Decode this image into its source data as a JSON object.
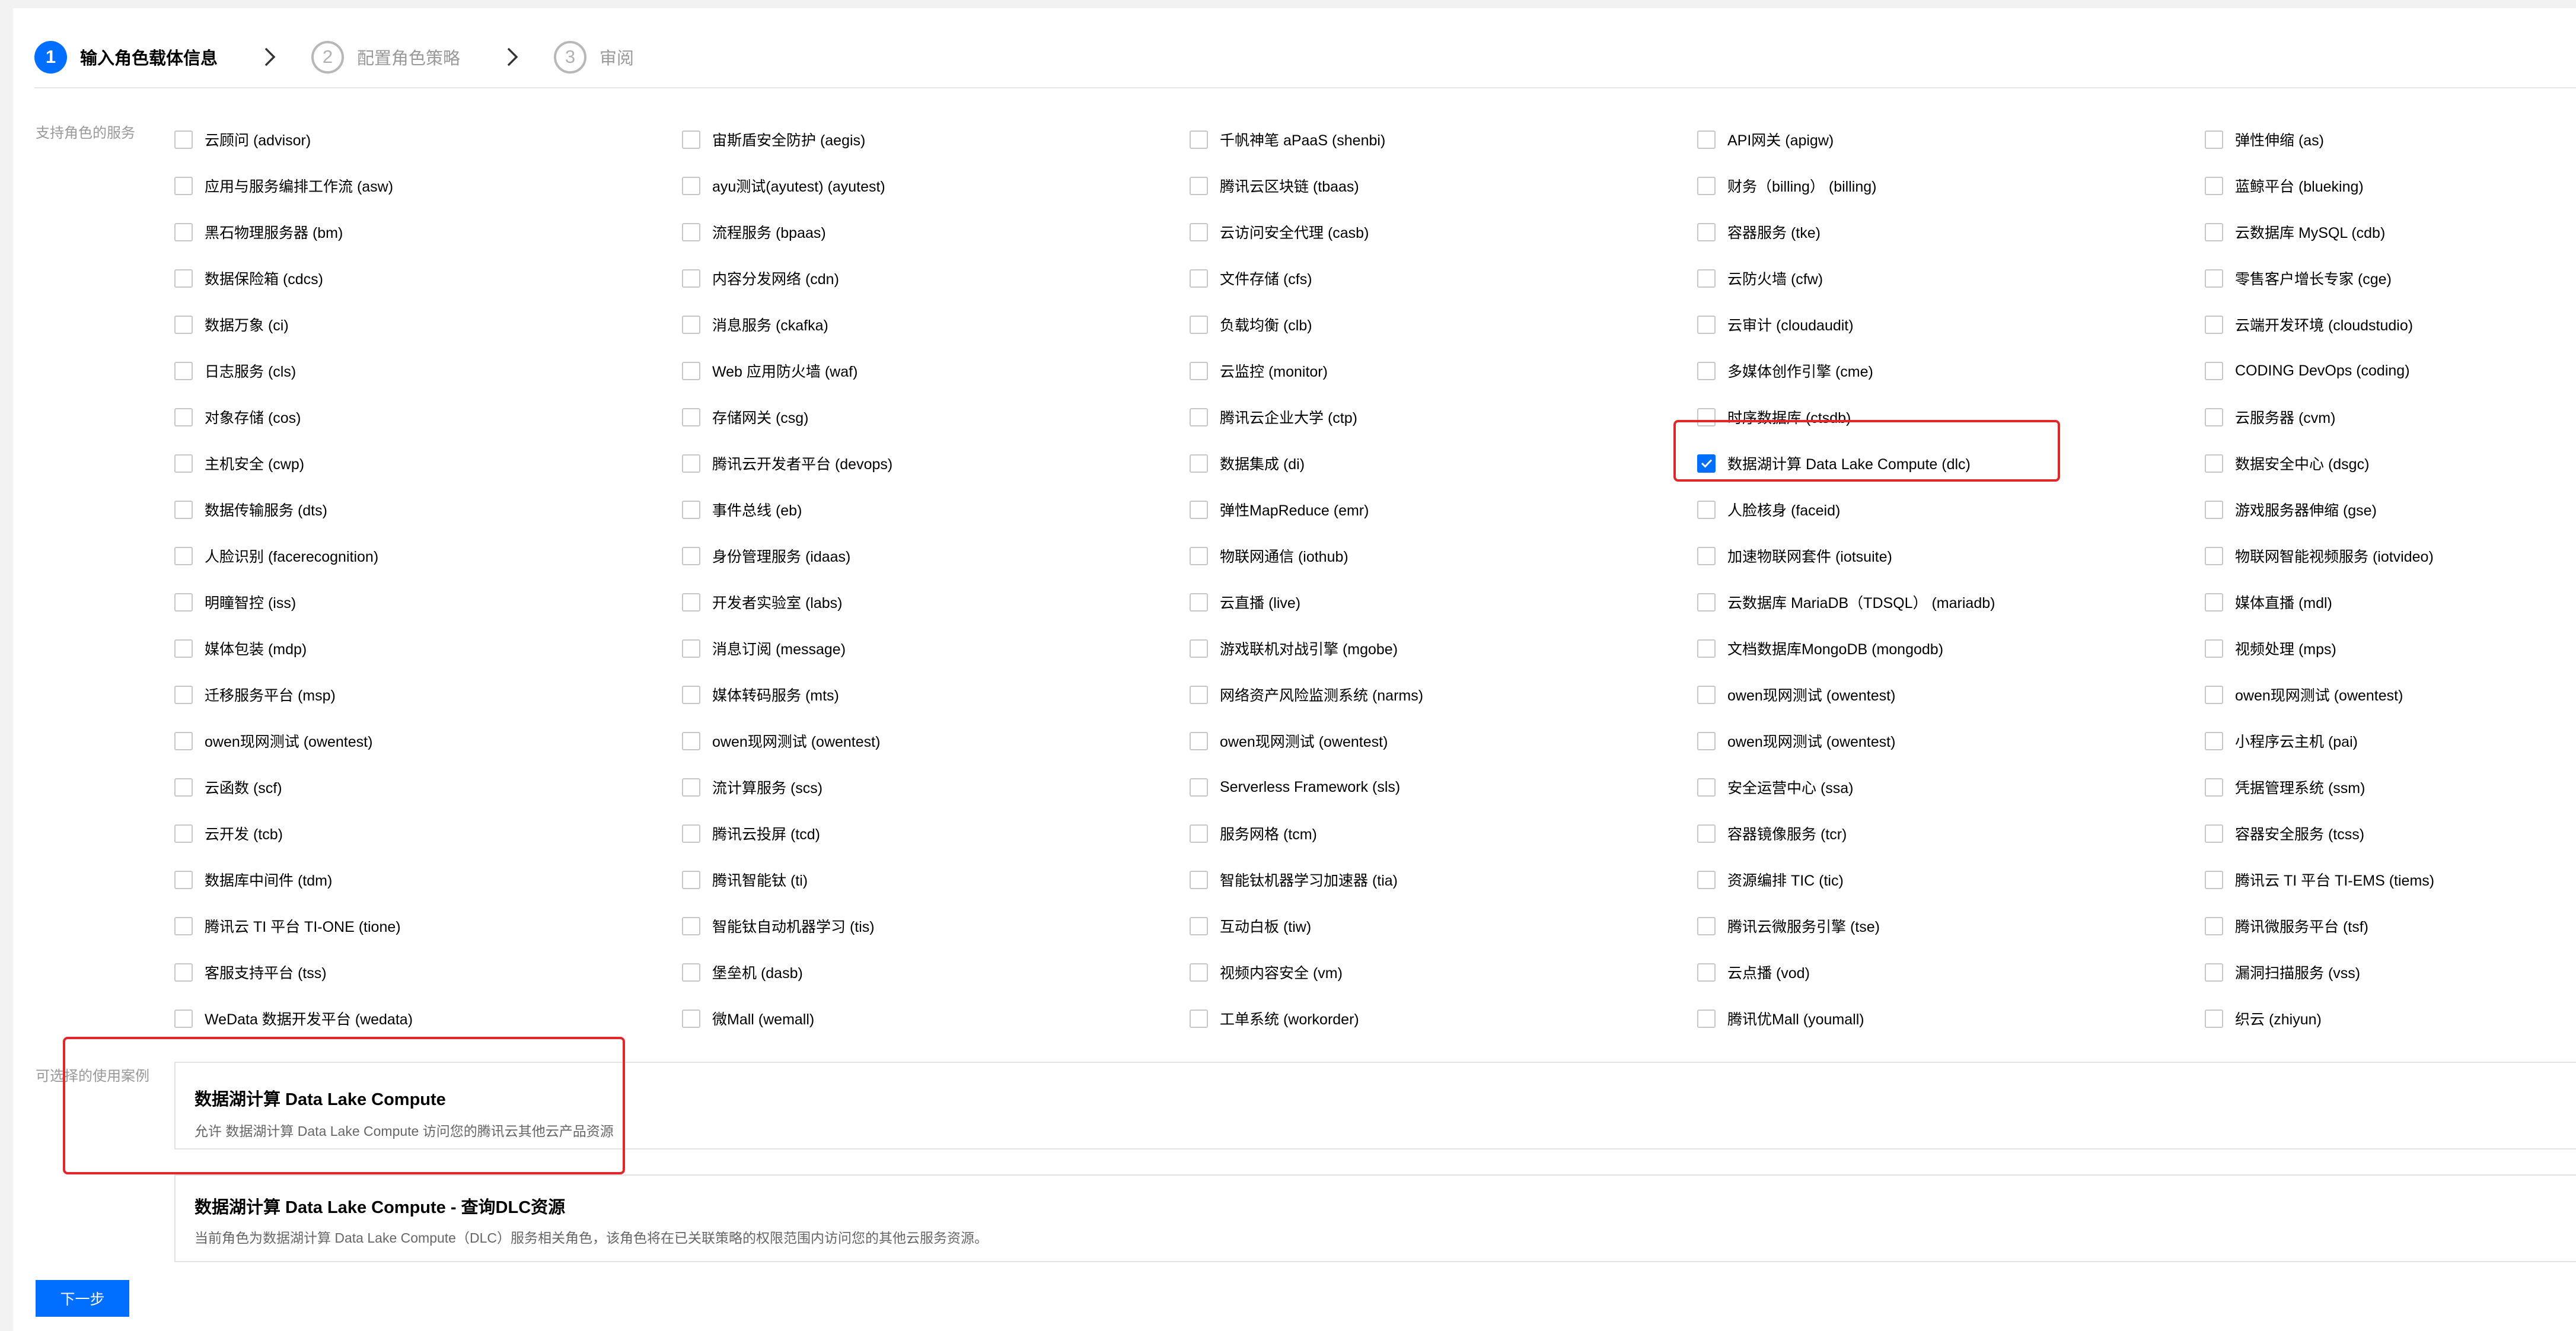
{
  "steps": [
    {
      "num": "1",
      "label": "输入角色载体信息"
    },
    {
      "num": "2",
      "label": "配置角色策略"
    },
    {
      "num": "3",
      "label": "审阅"
    }
  ],
  "services_label": "支持角色的服务",
  "use_cases_label": "可选择的使用案例",
  "services": [
    {
      "label": "云顾问 (advisor)",
      "checked": false
    },
    {
      "label": "宙斯盾安全防护 (aegis)",
      "checked": false
    },
    {
      "label": "千帆神笔 aPaaS (shenbi)",
      "checked": false
    },
    {
      "label": "API网关 (apigw)",
      "checked": false
    },
    {
      "label": "弹性伸缩 (as)",
      "checked": false
    },
    {
      "label": "应用与服务编排工作流 (asw)",
      "checked": false
    },
    {
      "label": "ayu测试(ayutest) (ayutest)",
      "checked": false
    },
    {
      "label": "腾讯云区块链 (tbaas)",
      "checked": false
    },
    {
      "label": "财务（billing） (billing)",
      "checked": false
    },
    {
      "label": "蓝鲸平台 (blueking)",
      "checked": false
    },
    {
      "label": "黑石物理服务器 (bm)",
      "checked": false
    },
    {
      "label": "流程服务 (bpaas)",
      "checked": false
    },
    {
      "label": "云访问安全代理 (casb)",
      "checked": false
    },
    {
      "label": "容器服务 (tke)",
      "checked": false
    },
    {
      "label": "云数据库 MySQL (cdb)",
      "checked": false
    },
    {
      "label": "数据保险箱 (cdcs)",
      "checked": false
    },
    {
      "label": "内容分发网络 (cdn)",
      "checked": false
    },
    {
      "label": "文件存储 (cfs)",
      "checked": false
    },
    {
      "label": "云防火墙 (cfw)",
      "checked": false
    },
    {
      "label": "零售客户增长专家 (cge)",
      "checked": false
    },
    {
      "label": "数据万象 (ci)",
      "checked": false
    },
    {
      "label": "消息服务 (ckafka)",
      "checked": false
    },
    {
      "label": "负载均衡 (clb)",
      "checked": false
    },
    {
      "label": "云审计 (cloudaudit)",
      "checked": false
    },
    {
      "label": "云端开发环境 (cloudstudio)",
      "checked": false
    },
    {
      "label": "日志服务 (cls)",
      "checked": false
    },
    {
      "label": "Web 应用防火墙 (waf)",
      "checked": false
    },
    {
      "label": "云监控 (monitor)",
      "checked": false
    },
    {
      "label": "多媒体创作引擎 (cme)",
      "checked": false
    },
    {
      "label": "CODING DevOps (coding)",
      "checked": false
    },
    {
      "label": "对象存储 (cos)",
      "checked": false
    },
    {
      "label": "存储网关 (csg)",
      "checked": false
    },
    {
      "label": "腾讯云企业大学 (ctp)",
      "checked": false
    },
    {
      "label": "时序数据库 (ctsdb)",
      "checked": false
    },
    {
      "label": "云服务器 (cvm)",
      "checked": false
    },
    {
      "label": "主机安全 (cwp)",
      "checked": false
    },
    {
      "label": "腾讯云开发者平台 (devops)",
      "checked": false
    },
    {
      "label": "数据集成 (di)",
      "checked": false
    },
    {
      "label": "数据湖计算 Data Lake Compute (dlc)",
      "checked": true
    },
    {
      "label": "数据安全中心 (dsgc)",
      "checked": false
    },
    {
      "label": "数据传输服务 (dts)",
      "checked": false
    },
    {
      "label": "事件总线 (eb)",
      "checked": false
    },
    {
      "label": "弹性MapReduce (emr)",
      "checked": false
    },
    {
      "label": "人脸核身 (faceid)",
      "checked": false
    },
    {
      "label": "游戏服务器伸缩 (gse)",
      "checked": false
    },
    {
      "label": "人脸识别 (facerecognition)",
      "checked": false
    },
    {
      "label": "身份管理服务 (idaas)",
      "checked": false
    },
    {
      "label": "物联网通信 (iothub)",
      "checked": false
    },
    {
      "label": "加速物联网套件 (iotsuite)",
      "checked": false
    },
    {
      "label": "物联网智能视频服务 (iotvideo)",
      "checked": false
    },
    {
      "label": "明瞳智控 (iss)",
      "checked": false
    },
    {
      "label": "开发者实验室 (labs)",
      "checked": false
    },
    {
      "label": "云直播 (live)",
      "checked": false
    },
    {
      "label": "云数据库 MariaDB（TDSQL） (mariadb)",
      "checked": false
    },
    {
      "label": "媒体直播 (mdl)",
      "checked": false
    },
    {
      "label": "媒体包装 (mdp)",
      "checked": false
    },
    {
      "label": "消息订阅 (message)",
      "checked": false
    },
    {
      "label": "游戏联机对战引擎 (mgobe)",
      "checked": false
    },
    {
      "label": "文档数据库MongoDB (mongodb)",
      "checked": false
    },
    {
      "label": "视频处理 (mps)",
      "checked": false
    },
    {
      "label": "迁移服务平台 (msp)",
      "checked": false
    },
    {
      "label": "媒体转码服务 (mts)",
      "checked": false
    },
    {
      "label": "网络资产风险监测系统 (narms)",
      "checked": false
    },
    {
      "label": "owen现网测试 (owentest)",
      "checked": false
    },
    {
      "label": "owen现网测试 (owentest)",
      "checked": false
    },
    {
      "label": "owen现网测试 (owentest)",
      "checked": false
    },
    {
      "label": "owen现网测试 (owentest)",
      "checked": false
    },
    {
      "label": "owen现网测试 (owentest)",
      "checked": false
    },
    {
      "label": "owen现网测试 (owentest)",
      "checked": false
    },
    {
      "label": "小程序云主机 (pai)",
      "checked": false
    },
    {
      "label": "云函数 (scf)",
      "checked": false
    },
    {
      "label": "流计算服务 (scs)",
      "checked": false
    },
    {
      "label": "Serverless Framework (sls)",
      "checked": false
    },
    {
      "label": "安全运营中心 (ssa)",
      "checked": false
    },
    {
      "label": "凭据管理系统 (ssm)",
      "checked": false
    },
    {
      "label": "云开发 (tcb)",
      "checked": false
    },
    {
      "label": "腾讯云投屏 (tcd)",
      "checked": false
    },
    {
      "label": "服务网格 (tcm)",
      "checked": false
    },
    {
      "label": "容器镜像服务 (tcr)",
      "checked": false
    },
    {
      "label": "容器安全服务 (tcss)",
      "checked": false
    },
    {
      "label": "数据库中间件 (tdm)",
      "checked": false
    },
    {
      "label": "腾讯智能钛 (ti)",
      "checked": false
    },
    {
      "label": "智能钛机器学习加速器 (tia)",
      "checked": false
    },
    {
      "label": "资源编排 TIC (tic)",
      "checked": false
    },
    {
      "label": "腾讯云 TI 平台 TI-EMS (tiems)",
      "checked": false
    },
    {
      "label": "腾讯云 TI 平台 TI-ONE (tione)",
      "checked": false
    },
    {
      "label": "智能钛自动机器学习 (tis)",
      "checked": false
    },
    {
      "label": "互动白板 (tiw)",
      "checked": false
    },
    {
      "label": "腾讯云微服务引擎 (tse)",
      "checked": false
    },
    {
      "label": "腾讯微服务平台 (tsf)",
      "checked": false
    },
    {
      "label": "客服支持平台 (tss)",
      "checked": false
    },
    {
      "label": "堡垒机 (dasb)",
      "checked": false
    },
    {
      "label": "视频内容安全 (vm)",
      "checked": false
    },
    {
      "label": "云点播 (vod)",
      "checked": false
    },
    {
      "label": "漏洞扫描服务 (vss)",
      "checked": false
    },
    {
      "label": "WeData 数据开发平台 (wedata)",
      "checked": false
    },
    {
      "label": "微Mall (wemall)",
      "checked": false
    },
    {
      "label": "工单系统 (workorder)",
      "checked": false
    },
    {
      "label": "腾讯优Mall (youmall)",
      "checked": false
    },
    {
      "label": "织云 (zhiyun)",
      "checked": false
    }
  ],
  "use_cases": [
    {
      "title": "数据湖计算 Data Lake Compute",
      "desc": "允许 数据湖计算 Data Lake Compute 访问您的腾讯云其他云产品资源"
    },
    {
      "title": "数据湖计算 Data Lake Compute - 查询DLC资源",
      "desc": "当前角色为数据湖计算 Data Lake Compute（DLC）服务相关角色，该角色将在已关联策略的权限范围内访问您的其他云服务资源。"
    }
  ],
  "next_button": "下一步",
  "colors": {
    "primary": "#006eff",
    "highlight": "#e0272b"
  }
}
